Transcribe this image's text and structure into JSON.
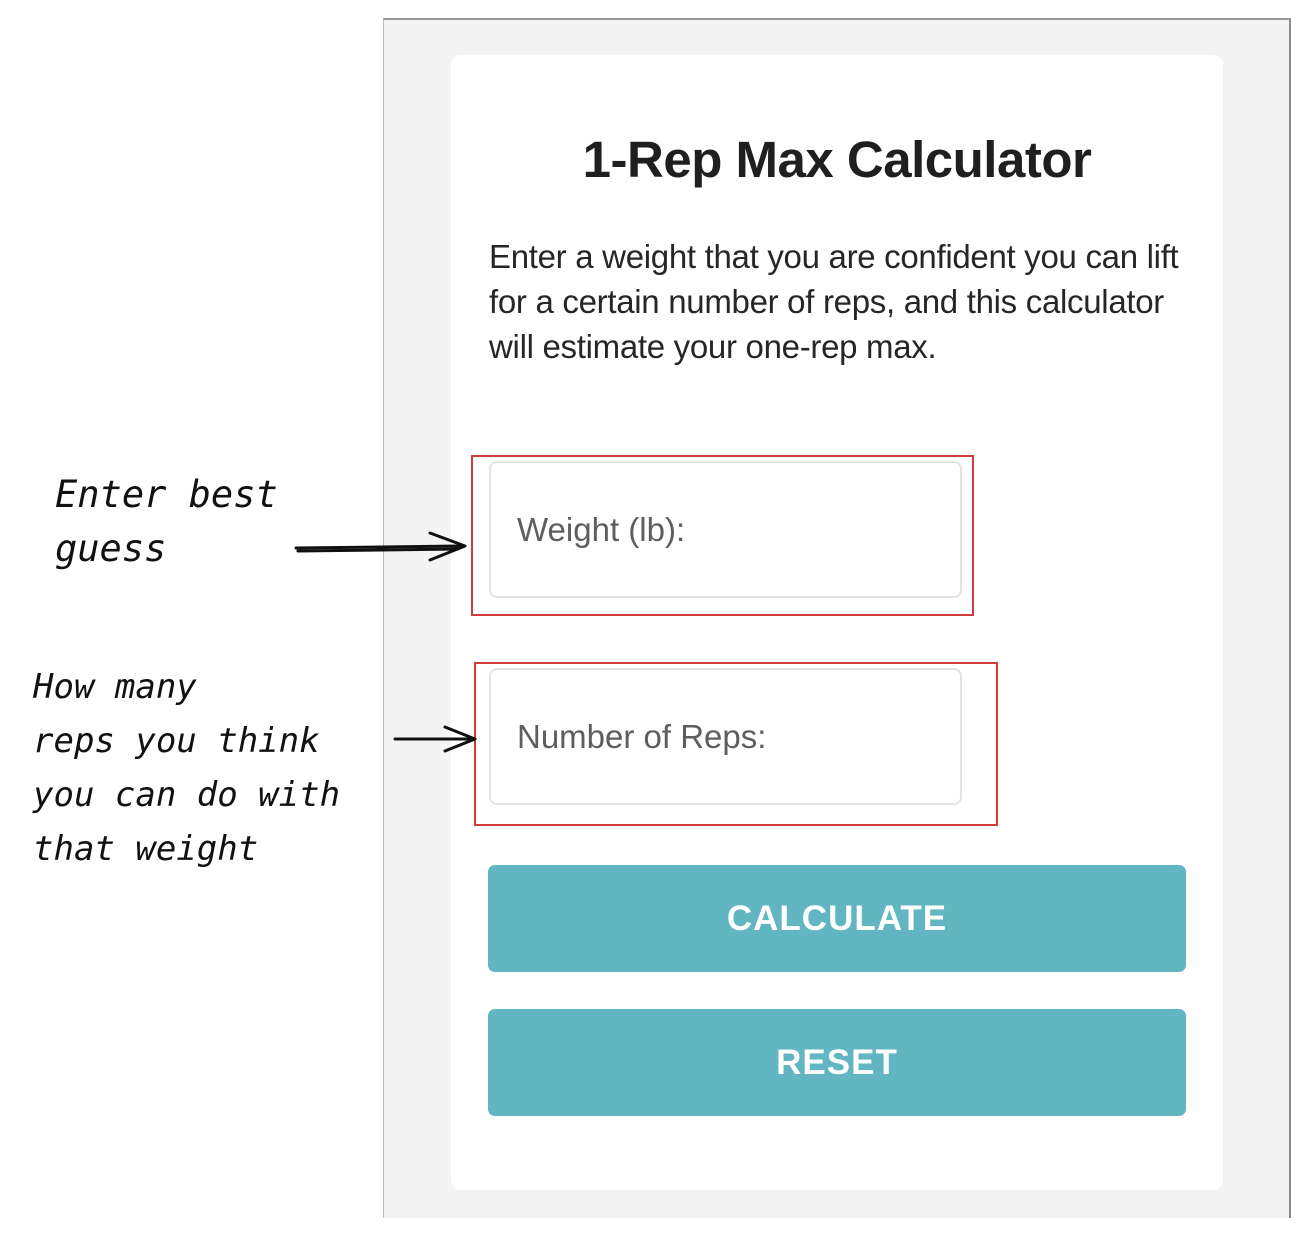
{
  "calculator": {
    "title": "1-Rep Max Calculator",
    "description": "Enter a weight that you are confident you can lift for a certain number of reps, and this calculator will estimate your one-rep max.",
    "weight_input": {
      "placeholder": "Weight (lb):",
      "value": ""
    },
    "reps_input": {
      "placeholder": "Number of Reps:",
      "value": ""
    },
    "calculate_label": "CALCULATE",
    "reset_label": "RESET"
  },
  "annotations": {
    "weight_note": "Enter best\nguess",
    "reps_note": "How many\nreps you think\nyou can do with\nthat weight"
  },
  "colors": {
    "button": "#62b6c1",
    "highlight": "#d03c3c",
    "background": "#f4f4f4"
  }
}
